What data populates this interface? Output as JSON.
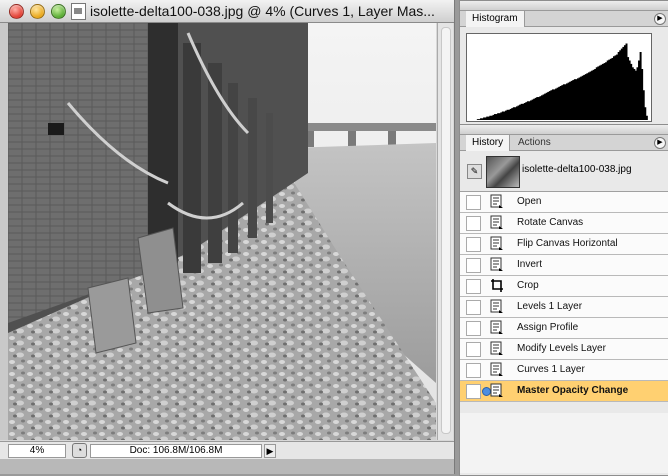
{
  "document": {
    "title": "isolette-delta100-038.jpg @ 4% (Curves 1, Layer Mas...",
    "zoom": "4%",
    "doc_size": "Doc: 106.8M/106.8M"
  },
  "histogram": {
    "tab_label": "Histogram",
    "bars": [
      0,
      0,
      0,
      0,
      0,
      1,
      1,
      2,
      2,
      3,
      3,
      4,
      4,
      5,
      5,
      6,
      7,
      7,
      8,
      8,
      9,
      10,
      10,
      11,
      12,
      12,
      13,
      14,
      15,
      15,
      16,
      17,
      18,
      19,
      19,
      20,
      21,
      22,
      22,
      23,
      24,
      25,
      26,
      27,
      27,
      28,
      29,
      30,
      31,
      32,
      33,
      34,
      35,
      36,
      36,
      37,
      38,
      39,
      40,
      41,
      42,
      42,
      43,
      44,
      45,
      46,
      47,
      48,
      48,
      49,
      50,
      51,
      52,
      53,
      54,
      55,
      56,
      57,
      58,
      59,
      60,
      62,
      63,
      64,
      65,
      66,
      67,
      68,
      70,
      71,
      72,
      73,
      75,
      76,
      77,
      80,
      82,
      84,
      86,
      88,
      90,
      74,
      70,
      66,
      62,
      60,
      58,
      62,
      70,
      80,
      60,
      35,
      15,
      5,
      0
    ]
  },
  "history": {
    "tabs": [
      "History",
      "Actions"
    ],
    "snapshot_name": "isolette-delta100-038.jpg",
    "steps": [
      {
        "label": "Open",
        "icon": "history-state-icon",
        "selected": false
      },
      {
        "label": "Rotate Canvas",
        "icon": "history-state-icon",
        "selected": false
      },
      {
        "label": "Flip Canvas Horizontal",
        "icon": "history-state-icon",
        "selected": false
      },
      {
        "label": "Invert",
        "icon": "history-state-icon",
        "selected": false
      },
      {
        "label": "Crop",
        "icon": "crop-icon",
        "selected": false
      },
      {
        "label": "Levels 1 Layer",
        "icon": "history-state-icon",
        "selected": false
      },
      {
        "label": "Assign Profile",
        "icon": "history-state-icon",
        "selected": false
      },
      {
        "label": "Modify Levels Layer",
        "icon": "history-state-icon",
        "selected": false
      },
      {
        "label": "Curves 1 Layer",
        "icon": "history-state-icon",
        "selected": false
      },
      {
        "label": "Master Opacity Change",
        "icon": "history-state-icon",
        "selected": true
      }
    ]
  }
}
